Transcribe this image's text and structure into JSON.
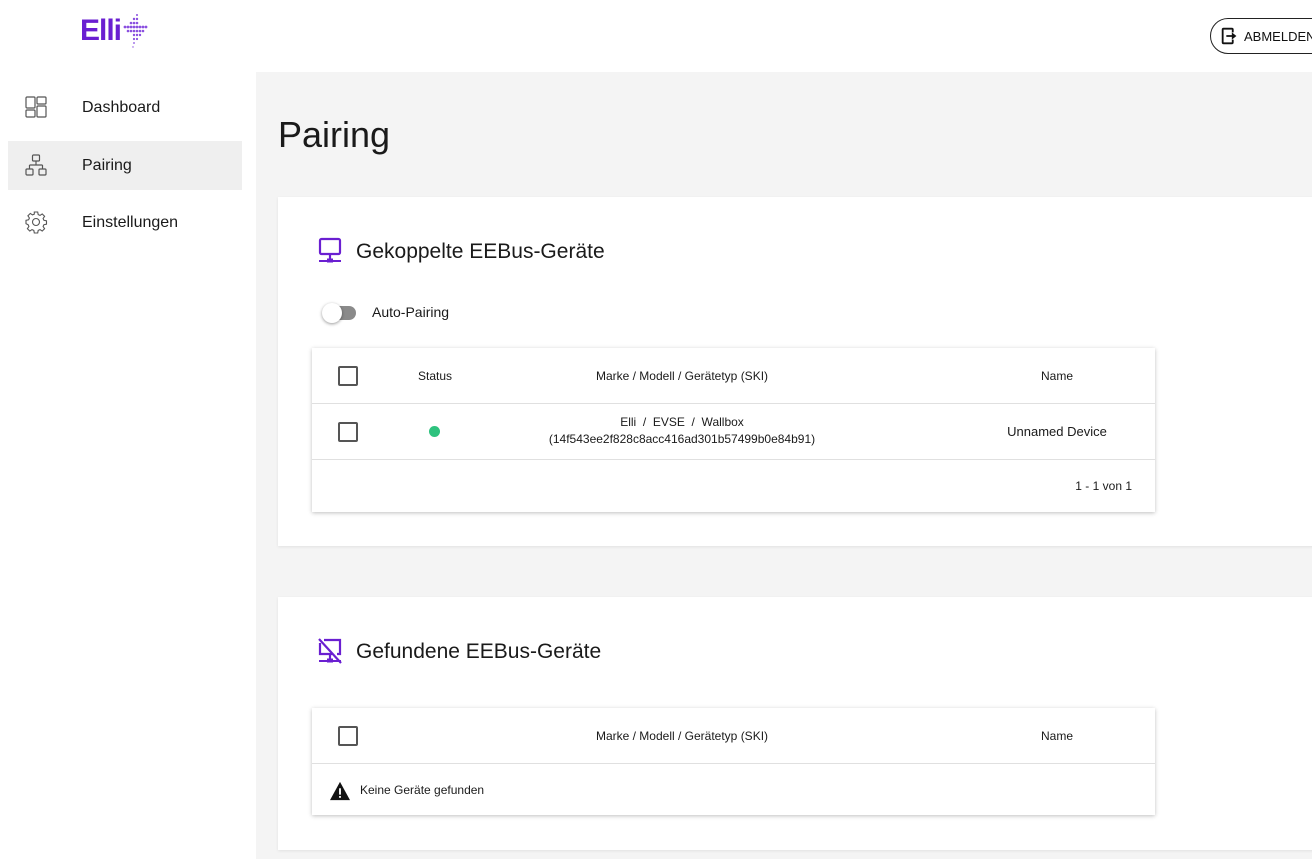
{
  "header": {
    "logo_text": "Elli",
    "logout_label": "ABMELDEN"
  },
  "sidebar": {
    "items": [
      {
        "label": "Dashboard",
        "icon": "dashboard-icon"
      },
      {
        "label": "Pairing",
        "icon": "network-icon",
        "active": true
      },
      {
        "label": "Einstellungen",
        "icon": "gear-icon"
      }
    ]
  },
  "page": {
    "title": "Pairing"
  },
  "paired": {
    "title": "Gekoppelte EEBus-Geräte",
    "icon": "monitor-network-icon",
    "auto_pairing_label": "Auto-Pairing",
    "auto_pairing_enabled": false,
    "columns": {
      "status": "Status",
      "device": "Marke / Modell / Gerätetyp (SKI)",
      "name": "Name"
    },
    "rows": [
      {
        "status": "online",
        "device_line1": "Elli  /  EVSE  /  Wallbox",
        "device_line2": "(14f543ee2f828c8acc416ad301b57499b0e84b91)",
        "name": "Unnamed Device"
      }
    ],
    "pagination": "1 - 1 von 1"
  },
  "found": {
    "title": "Gefundene EEBus-Geräte",
    "icon": "monitor-off-icon",
    "columns": {
      "device": "Marke / Modell / Gerätetyp (SKI)",
      "name": "Name"
    },
    "empty_message": "Keine Geräte gefunden"
  },
  "colors": {
    "brand": "#6a1fd1",
    "status_online": "#2ec27e"
  }
}
